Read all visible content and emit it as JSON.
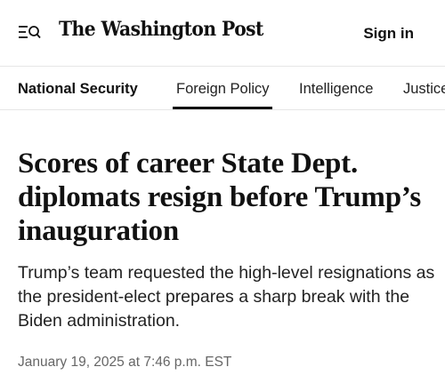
{
  "header": {
    "menu_icon": "menu-search-icon",
    "logo_text": "The Washington Post",
    "signin_label": "Sign in"
  },
  "subnav": {
    "section_label": "National Security",
    "items": [
      {
        "label": "Foreign Policy",
        "active": true
      },
      {
        "label": "Intelligence",
        "active": false
      },
      {
        "label": "Justice",
        "active": false
      }
    ]
  },
  "article": {
    "headline": "Scores of career State Dept. diplomats resign before Trump’s inauguration",
    "dek": "Trump’s team requested the high-level resignations as the president-elect prepares a sharp break with the Biden administration.",
    "timestamp": "January 19, 2025 at 7:46 p.m. EST"
  }
}
